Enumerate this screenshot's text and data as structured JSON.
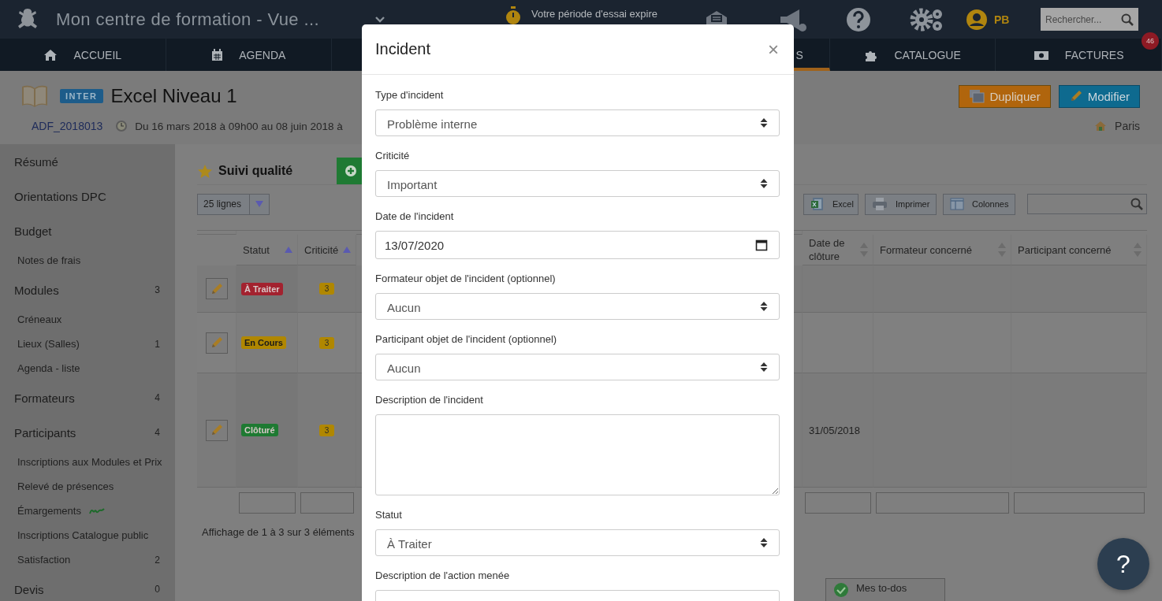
{
  "topbar": {
    "title": "Mon centre de formation - Vue ...",
    "trial_notice": "Votre période d'essai expire",
    "user_initials": "PB",
    "search": {
      "placeholder": "Rechercher..."
    }
  },
  "nav": {
    "tabs": [
      {
        "label": "ACCUEIL",
        "kind": "home",
        "selected": false
      },
      {
        "label": "AGENDA",
        "kind": "calendar",
        "selected": false
      },
      {
        "label": "S",
        "kind": "plain",
        "selected": true
      },
      {
        "label": "CATALOGUE",
        "kind": "puzzle",
        "selected": false
      },
      {
        "label": "FACTURES",
        "kind": "bills",
        "selected": false,
        "badge": "46"
      }
    ]
  },
  "course": {
    "type_badge": "INTER",
    "title": "Excel Niveau 1",
    "code": "ADF_2018013",
    "dates": "Du 16 mars 2018 à 09h00 au 08 juin 2018 à",
    "location": "Paris",
    "buttons": [
      {
        "label": "Dupliquer",
        "kind": "duplicate"
      },
      {
        "label": "Modifier",
        "kind": "edit"
      }
    ]
  },
  "sidebar": {
    "items": [
      {
        "label": "Résumé"
      },
      {
        "label": "Orientations DPC"
      },
      {
        "label": "Budget",
        "children": [
          {
            "label": "Notes de frais",
            "kind": "link"
          }
        ]
      },
      {
        "label": "Modules",
        "count": "3",
        "children": [
          {
            "label": "Créneaux",
            "kind": "link"
          },
          {
            "label": "Lieux (Salles)",
            "kind": "link",
            "count": "1"
          },
          {
            "label": "Agenda - liste",
            "kind": "link"
          }
        ]
      },
      {
        "label": "Formateurs",
        "count": "4"
      },
      {
        "label": "Participants",
        "count": "4",
        "children": [
          {
            "label": "Inscriptions aux Modules et Prix",
            "kind": "link"
          },
          {
            "label": "Relevé de présences",
            "kind": "link"
          },
          {
            "label": "Émargements",
            "kind": "signature"
          },
          {
            "label": "Inscriptions Catalogue public",
            "kind": "link"
          },
          {
            "label": "Satisfaction",
            "kind": "link",
            "count": "2"
          }
        ]
      },
      {
        "label": "Devis",
        "count": "0"
      }
    ]
  },
  "quality": {
    "title": "Suivi qualité",
    "page_size": "25 lignes",
    "toolbar": [
      {
        "label": "Excel",
        "kind": "excel"
      },
      {
        "label": "Imprimer",
        "kind": "print"
      },
      {
        "label": "Colonnes",
        "kind": "columns"
      }
    ],
    "table": {
      "columns": [
        {
          "label": "Statut",
          "sorted": true
        },
        {
          "label": "Criticité",
          "sorted": true
        },
        {
          "label": "Date de clôture",
          "sorted": false
        },
        {
          "label": "Formateur concerné",
          "sorted": false
        },
        {
          "label": "Participant concerné",
          "sorted": false
        }
      ],
      "rows": [
        {
          "status": {
            "text": "À Traiter",
            "color": "#a3222f"
          },
          "criticality": "3"
        },
        {
          "status": {
            "text": "En Cours",
            "color": "#b08700"
          },
          "criticality": "3"
        },
        {
          "status": {
            "text": "Clôturé",
            "color": "#1e7a32"
          },
          "criticality": "3",
          "closing_date": "31/05/2018"
        }
      ]
    },
    "summary": "Affichage de 1 à 3 sur 3 éléments"
  },
  "todos": {
    "label": "Mes to-dos"
  },
  "help_button": {
    "label": "?"
  },
  "modal": {
    "title": "Incident",
    "close": "×",
    "fields": [
      {
        "kind": "select",
        "label": "Type d'incident",
        "value": "Problème interne"
      },
      {
        "kind": "select",
        "label": "Criticité",
        "value": "Important"
      },
      {
        "kind": "date",
        "label": "Date de l'incident",
        "value": "13/07/2020"
      },
      {
        "kind": "select",
        "label": "Formateur objet de l'incident (optionnel)",
        "value": "Aucun"
      },
      {
        "kind": "select",
        "label": "Participant objet de l'incident (optionnel)",
        "value": "Aucun"
      },
      {
        "kind": "textarea",
        "label": "Description de l'incident"
      },
      {
        "kind": "select",
        "label": "Statut",
        "value": "À Traiter"
      },
      {
        "kind": "textarea",
        "label": "Description de l'action menée"
      }
    ]
  }
}
